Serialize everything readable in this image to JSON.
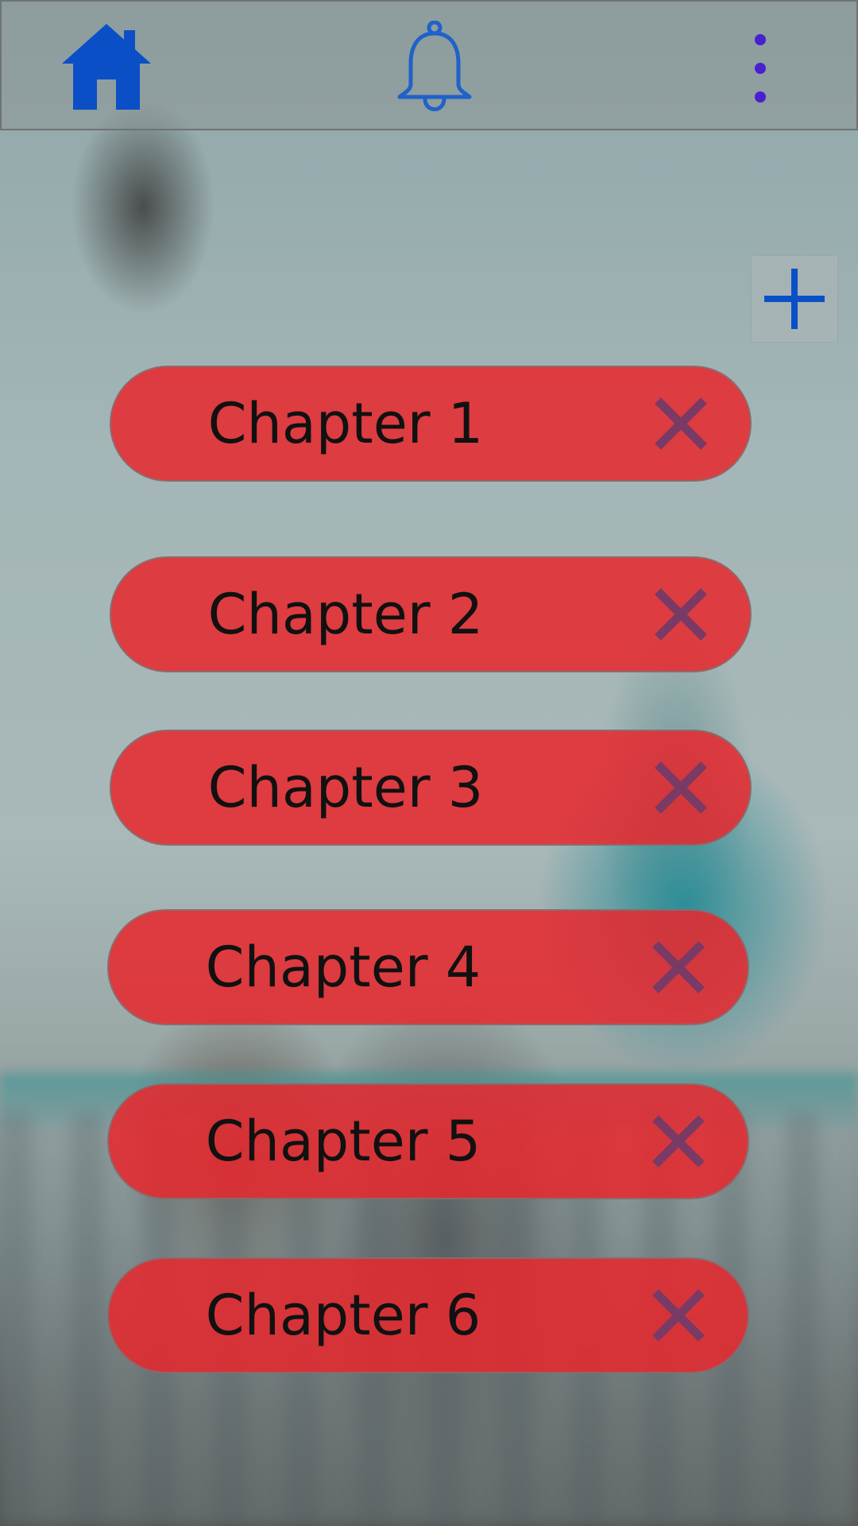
{
  "header": {
    "home_icon": "home-icon",
    "notifications_icon": "bell-icon",
    "more_icon": "more-vertical-icon",
    "colors": {
      "home": "#0b4fc6",
      "bell": "#1f62c9",
      "more": "#4a1fd0"
    }
  },
  "add_button": {
    "icon": "plus-icon",
    "color": "#0b4fc6"
  },
  "chapters": [
    {
      "label": "Chapter 1",
      "delete_icon": "close-icon"
    },
    {
      "label": "Chapter 2",
      "delete_icon": "close-icon"
    },
    {
      "label": "Chapter 3",
      "delete_icon": "close-icon"
    },
    {
      "label": "Chapter 4",
      "delete_icon": "close-icon"
    },
    {
      "label": "Chapter 5",
      "delete_icon": "close-icon"
    },
    {
      "label": "Chapter 6",
      "delete_icon": "close-icon"
    }
  ],
  "colors": {
    "chapter_fill": "#e3282d",
    "delete_icon": "#7a3a66"
  }
}
